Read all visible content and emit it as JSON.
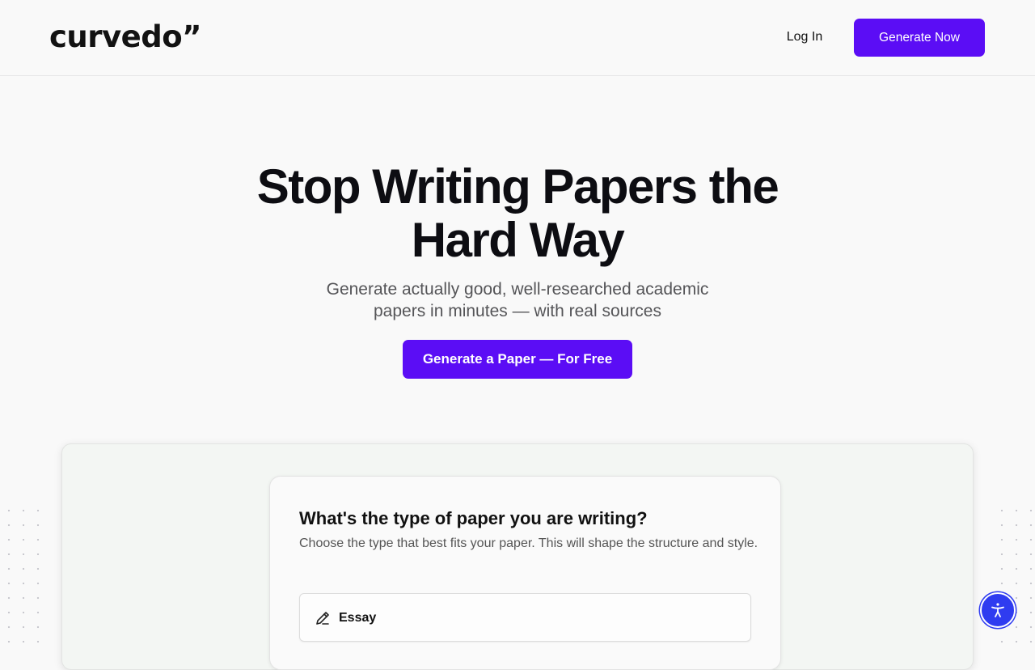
{
  "header": {
    "logo": "curvedo”",
    "login_label": "Log In",
    "generate_now_label": "Generate Now"
  },
  "hero": {
    "title_line1": "Stop Writing Papers the",
    "title_line2": "Hard Way",
    "subtitle_line1": "Generate actually good, well-researched academic",
    "subtitle_line2": "papers in minutes — with real sources",
    "cta_label": "Generate a Paper — For Free"
  },
  "preview": {
    "question": "What's the type of paper you are writing?",
    "description": "Choose the type that best fits your paper. This will shape the structure and style.",
    "options": [
      {
        "label": "Essay",
        "icon": "pencil-icon"
      }
    ]
  },
  "accessibility": {
    "icon": "accessibility-icon"
  },
  "colors": {
    "primary": "#5b0df5",
    "accessibility_button": "#2f3cf0"
  }
}
